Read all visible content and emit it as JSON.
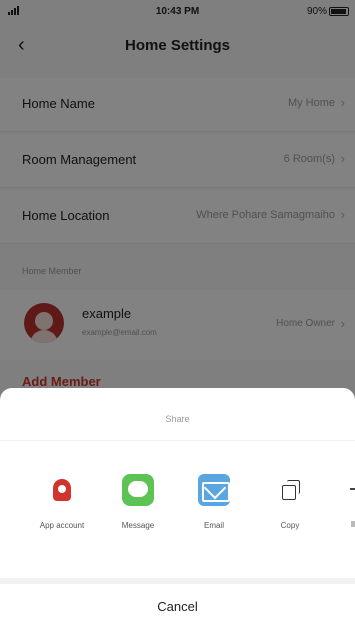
{
  "status_bar": {
    "time": "10:43 PM",
    "battery": "90%"
  },
  "nav": {
    "back_icon": "chevron-left",
    "title": "Home Settings"
  },
  "settings": [
    {
      "label": "Home Name",
      "value": "My Home"
    },
    {
      "label": "Room Management",
      "value": "6 Room(s)"
    },
    {
      "label": "Home Location",
      "value": "Where Pohare Samagmaiho"
    }
  ],
  "members_section": {
    "header": "Home Member"
  },
  "member": {
    "name": "example",
    "email": "example@email.com",
    "role": "Home Owner"
  },
  "add_member_label": "Add Member",
  "share_sheet": {
    "title": "Share",
    "items": [
      {
        "label": "App account",
        "icon": "app-logo-icon"
      },
      {
        "label": "Message",
        "icon": "message-icon"
      },
      {
        "label": "Email",
        "icon": "mail-icon"
      },
      {
        "label": "Copy",
        "icon": "copy-icon"
      }
    ],
    "cancel_label": "Cancel"
  },
  "colors": {
    "accent_red": "#d0342c",
    "message_green": "#5cc354",
    "mail_blue": "#5aa6e0"
  }
}
